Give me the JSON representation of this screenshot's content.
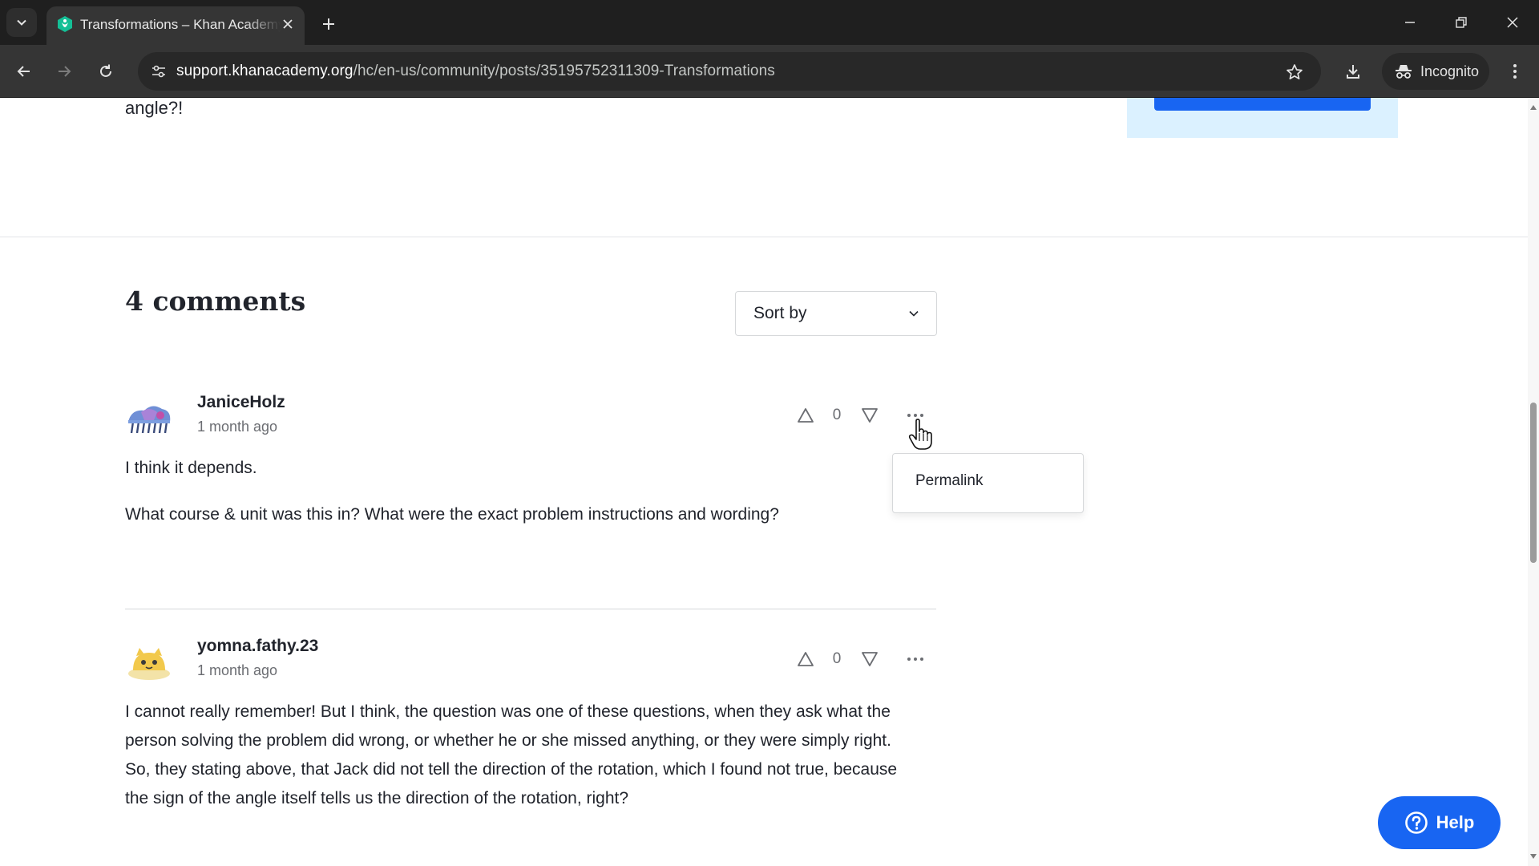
{
  "browser": {
    "tab_title": "Transformations – Khan Academy",
    "url_host": "support.khanacademy.org",
    "url_path": "/hc/en-us/community/posts/35195752311309-Transformations",
    "incognito_label": "Incognito"
  },
  "post": {
    "tail_text": "angle?!"
  },
  "comments": {
    "heading": "4 comments",
    "sort_label": "Sort by",
    "items": [
      {
        "author": "JaniceHolz",
        "time": "1 month ago",
        "votes": "0",
        "body": [
          "I think it depends.",
          "What course & unit was this in?  What were the exact problem instructions and wording?"
        ]
      },
      {
        "author": "yomna.fathy.23",
        "time": "1 month ago",
        "votes": "0",
        "body": [
          "I cannot really remember! But I think, the question was one of these questions, when they ask what the",
          "person solving the problem did wrong, or whether he or she missed anything, or they were simply right.",
          "So, they stating above, that Jack did not tell the direction of the rotation, which I found not true, because",
          "the sign of the angle itself tells us the direction of the rotation, right?"
        ]
      }
    ]
  },
  "popover": {
    "permalink_label": "Permalink"
  },
  "help": {
    "label": "Help"
  },
  "colors": {
    "brand_blue": "#1865f2",
    "khan_green": "#14bf96",
    "side_box_bg": "#dbf1ff"
  }
}
